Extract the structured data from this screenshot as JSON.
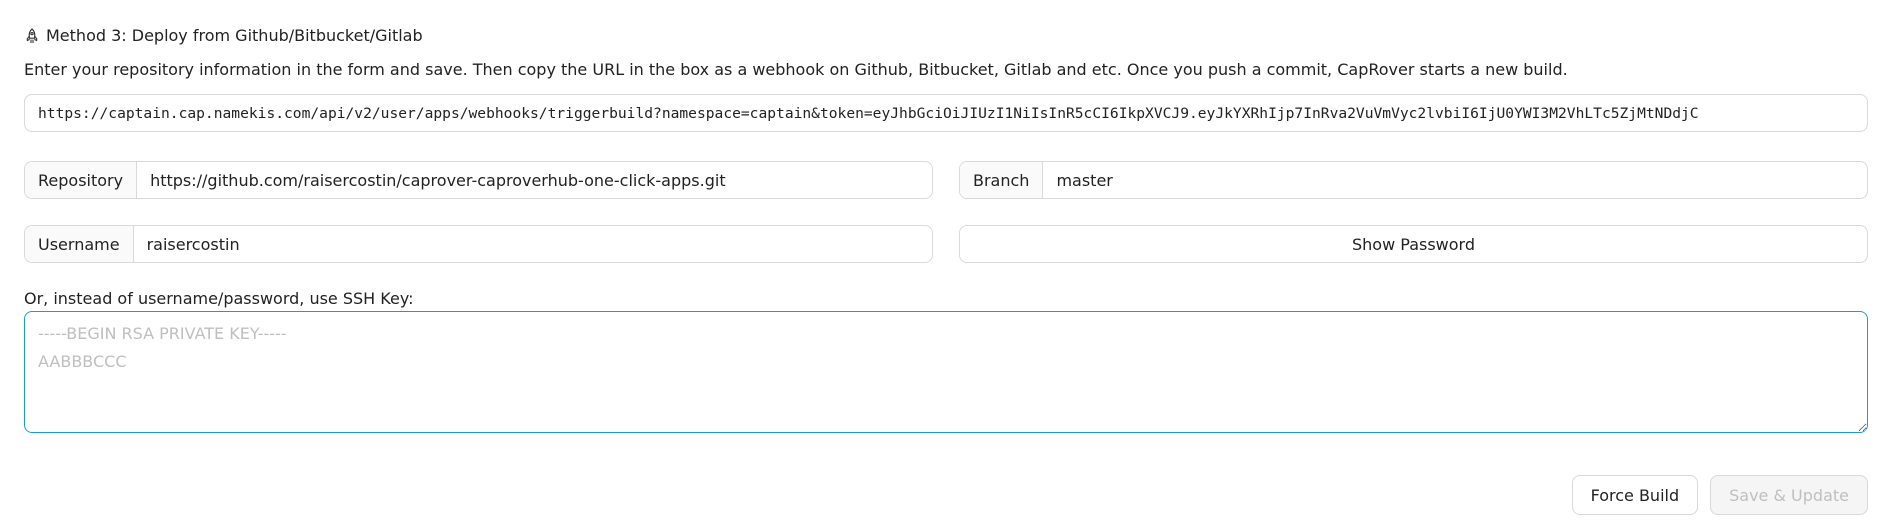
{
  "section": {
    "title": "Method 3: Deploy from Github/Bitbucket/Gitlab",
    "icon": "rocket-icon",
    "description": "Enter your repository information in the form and save. Then copy the URL in the box as a webhook on Github, Bitbucket, Gitlab and etc. Once you push a commit, CapRover starts a new build."
  },
  "webhook": {
    "url": "https://captain.cap.namekis.com/api/v2/user/apps/webhooks/triggerbuild?namespace=captain&token=eyJhbGciOiJIUzI1NiIsInR5cCI6IkpXVCJ9.eyJkYXRhIjp7InRva2VuVmVyc2lvbiI6IjU0YWI3M2VhLTc5ZjMtNDdjC"
  },
  "form": {
    "repository": {
      "label": "Repository",
      "value": "https://github.com/raisercostin/caprover-caproverhub-one-click-apps.git"
    },
    "branch": {
      "label": "Branch",
      "value": "master"
    },
    "username": {
      "label": "Username",
      "value": "raisercostin"
    },
    "show_password_label": "Show Password",
    "ssh": {
      "label": "Or, instead of username/password, use SSH Key:",
      "placeholder": "-----BEGIN RSA PRIVATE KEY-----\nAABBBCCC",
      "value": ""
    }
  },
  "actions": {
    "force_build_label": "Force Build",
    "save_update_label": "Save & Update"
  },
  "colors": {
    "focus_border": "#1c9ad6",
    "border": "#d9d9d9",
    "placeholder": "#bfbfbf"
  }
}
